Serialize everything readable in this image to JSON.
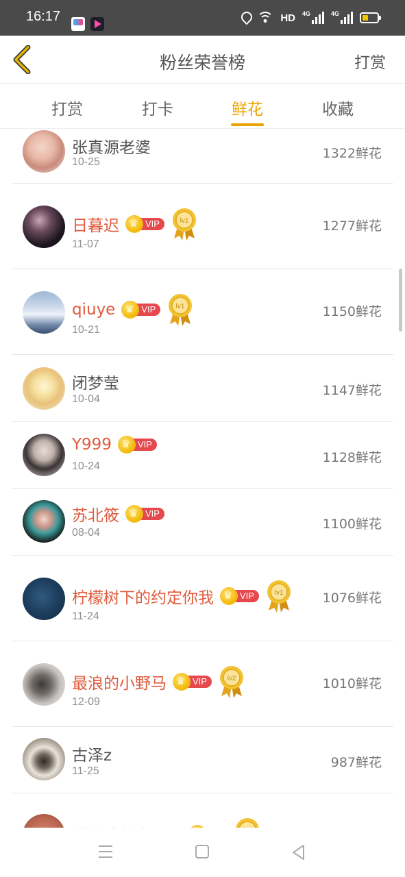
{
  "status_bar": {
    "time": "16:17",
    "network": "HD",
    "sim1": "4G",
    "sim2": "4G"
  },
  "header": {
    "title": "粉丝荣誉榜",
    "action_label": "打赏"
  },
  "tabs": [
    {
      "label": "打赏",
      "active": false
    },
    {
      "label": "打卡",
      "active": false
    },
    {
      "label": "鲜花",
      "active": true
    },
    {
      "label": "收藏",
      "active": false
    }
  ],
  "vip_label": "VIP",
  "colors": {
    "accent": "#eea400",
    "vip_name": "#e05a3c",
    "vip_badge": "#e5484d"
  },
  "list": [
    {
      "name": "张真源老婆",
      "date": "10-25",
      "count": "1322鲜花",
      "vip": false,
      "medal": ""
    },
    {
      "name": "日暮迟",
      "date": "11-07",
      "count": "1277鲜花",
      "vip": true,
      "medal": "lv1"
    },
    {
      "name": "qiuye",
      "date": "10-21",
      "count": "1150鲜花",
      "vip": true,
      "medal": "lv1"
    },
    {
      "name": "闭梦莹",
      "date": "10-04",
      "count": "1147鲜花",
      "vip": false,
      "medal": ""
    },
    {
      "name": "Y999",
      "date": "10-24",
      "count": "1128鲜花",
      "vip": true,
      "medal": ""
    },
    {
      "name": "苏北筱",
      "date": "08-04",
      "count": "1100鲜花",
      "vip": true,
      "medal": ""
    },
    {
      "name": "柠檬树下的约定你我",
      "date": "11-24",
      "count": "1076鲜花",
      "vip": true,
      "medal": "lv1"
    },
    {
      "name": "最浪的小野马",
      "date": "12-09",
      "count": "1010鲜花",
      "vip": true,
      "medal": "lv2"
    },
    {
      "name": "古泽z",
      "date": "11-25",
      "count": "987鲜花",
      "vip": false,
      "medal": ""
    },
    {
      "name": "草莓味的李子园",
      "date": "",
      "count": "",
      "vip": true,
      "medal": "lv1"
    }
  ]
}
